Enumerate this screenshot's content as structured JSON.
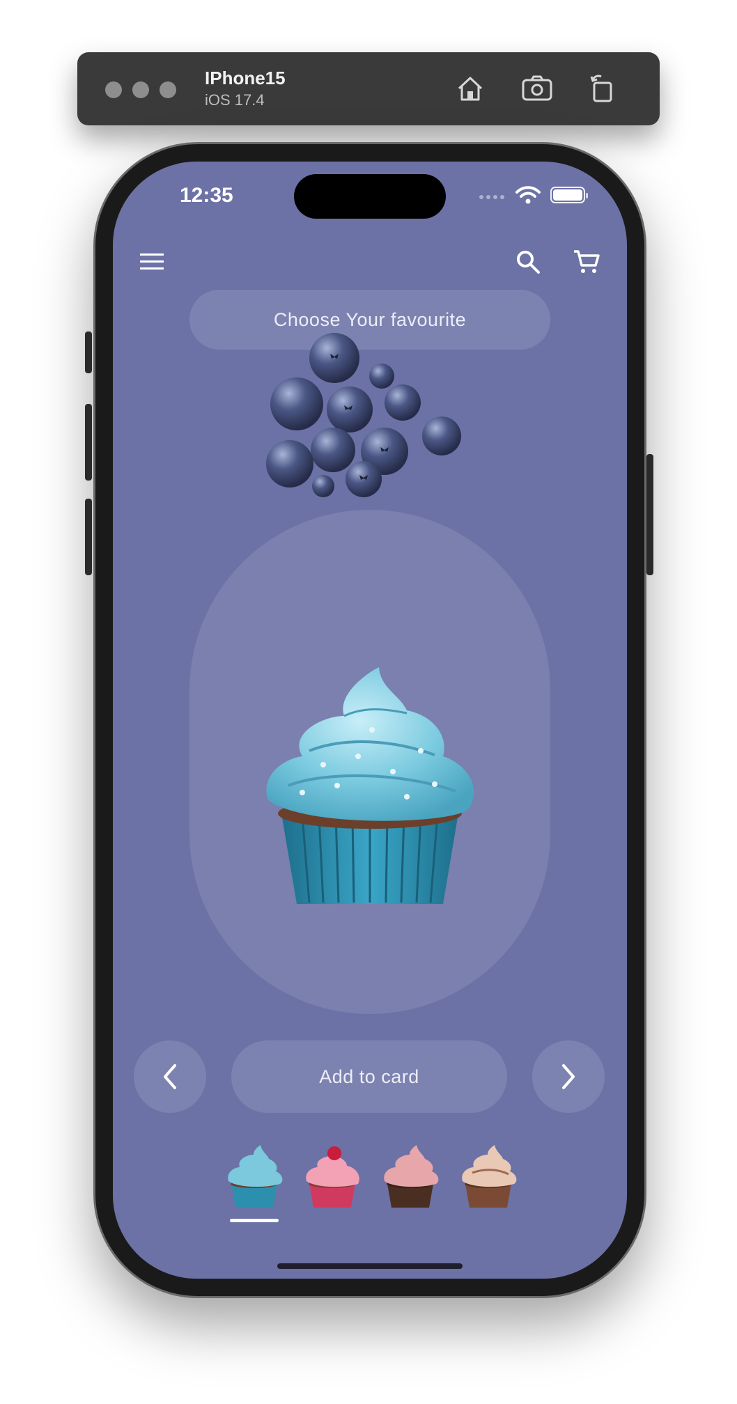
{
  "simulator": {
    "device_name": "IPhone15",
    "os_version": "iOS 17.4",
    "icons": [
      "home-icon",
      "screenshot-icon",
      "rotate-icon"
    ]
  },
  "status_bar": {
    "time": "12:35",
    "icons": [
      "cellular-signal-icon",
      "wifi-icon",
      "battery-icon"
    ]
  },
  "app_bar": {
    "icons": [
      "menu-icon",
      "search-icon",
      "cart-icon"
    ]
  },
  "header": {
    "title": "Choose Your favourite"
  },
  "hero": {
    "decoration": "blueberries",
    "product": "blue cupcake"
  },
  "actions": {
    "prev_icon": "chevron-left-icon",
    "add_label": "Add to card",
    "next_icon": "chevron-right-icon"
  },
  "thumbnails": [
    {
      "name": "blue cupcake",
      "frosting": "#7cc8dc",
      "liner": "#2c8fae",
      "selected": true
    },
    {
      "name": "pink cupcake",
      "frosting": "#f3a2b6",
      "liner": "#d13a5f",
      "selected": false
    },
    {
      "name": "chocolate cupcake",
      "frosting": "#e6a6aa",
      "liner": "#4a2e22",
      "selected": false
    },
    {
      "name": "caramel cupcake",
      "frosting": "#e9c9b6",
      "liner": "#7b4a34",
      "selected": false
    }
  ],
  "colors": {
    "background": "#6c72a5",
    "surface": "rgba(255,255,255,0.12)",
    "text": "#ecedf6"
  }
}
